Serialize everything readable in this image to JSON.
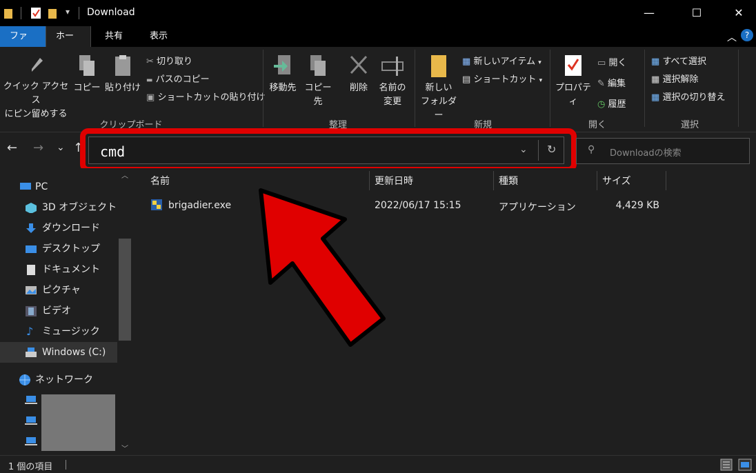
{
  "window": {
    "title": "Download",
    "minimize": "—",
    "maximize": "☐",
    "close": "✕"
  },
  "tabs": [
    {
      "label": "ファイル"
    },
    {
      "label": "ホーム"
    },
    {
      "label": "共有"
    },
    {
      "label": "表示"
    }
  ],
  "ribbon": {
    "quick_access": "クイック アクセス\nにピン留めする",
    "copy": "コピー",
    "paste": "貼り付け",
    "cut": "切り取り",
    "copy_path": "パスのコピー",
    "paste_shortcut": "ショートカットの貼り付け",
    "move_to": "移動先",
    "copy_to": "コピー先",
    "delete": "削除",
    "rename_1": "名前の",
    "rename_2": "変更",
    "new_folder_1": "新しい",
    "new_folder_2": "フォルダー",
    "new_item": "新しいアイテム",
    "shortcut": "ショートカット",
    "properties": "プロパティ",
    "open": "開く",
    "edit": "編集",
    "history": "履歴",
    "select_all": "すべて選択",
    "select_none": "選択解除",
    "invert_selection": "選択の切り替え",
    "groups": {
      "clipboard": "クリップボード",
      "organize": "整理",
      "new": "新規",
      "open": "開く",
      "select": "選択"
    }
  },
  "address": {
    "value": "cmd",
    "search_placeholder": "Downloadの検索"
  },
  "nav": {
    "back": "←",
    "forward": "→",
    "recent": "⌄",
    "up": "↑"
  },
  "sidebar": {
    "items": [
      {
        "label": "PC"
      },
      {
        "label": "3D オブジェクト"
      },
      {
        "label": "ダウンロード"
      },
      {
        "label": "デスクトップ"
      },
      {
        "label": "ドキュメント"
      },
      {
        "label": "ピクチャ"
      },
      {
        "label": "ビデオ"
      },
      {
        "label": "ミュージック"
      },
      {
        "label": "Windows (C:)"
      },
      {
        "label": "ネットワーク"
      }
    ]
  },
  "columns": {
    "name": "名前",
    "date": "更新日時",
    "type": "種類",
    "size": "サイズ"
  },
  "files": [
    {
      "name": "brigadier.exe",
      "date": "2022/06/17 15:15",
      "type": "アプリケーション",
      "size": "4,429 KB"
    }
  ],
  "status": {
    "count": "1 個の項目"
  },
  "colors": {
    "accent": "#1a6fc4",
    "highlight": "#e00000"
  }
}
